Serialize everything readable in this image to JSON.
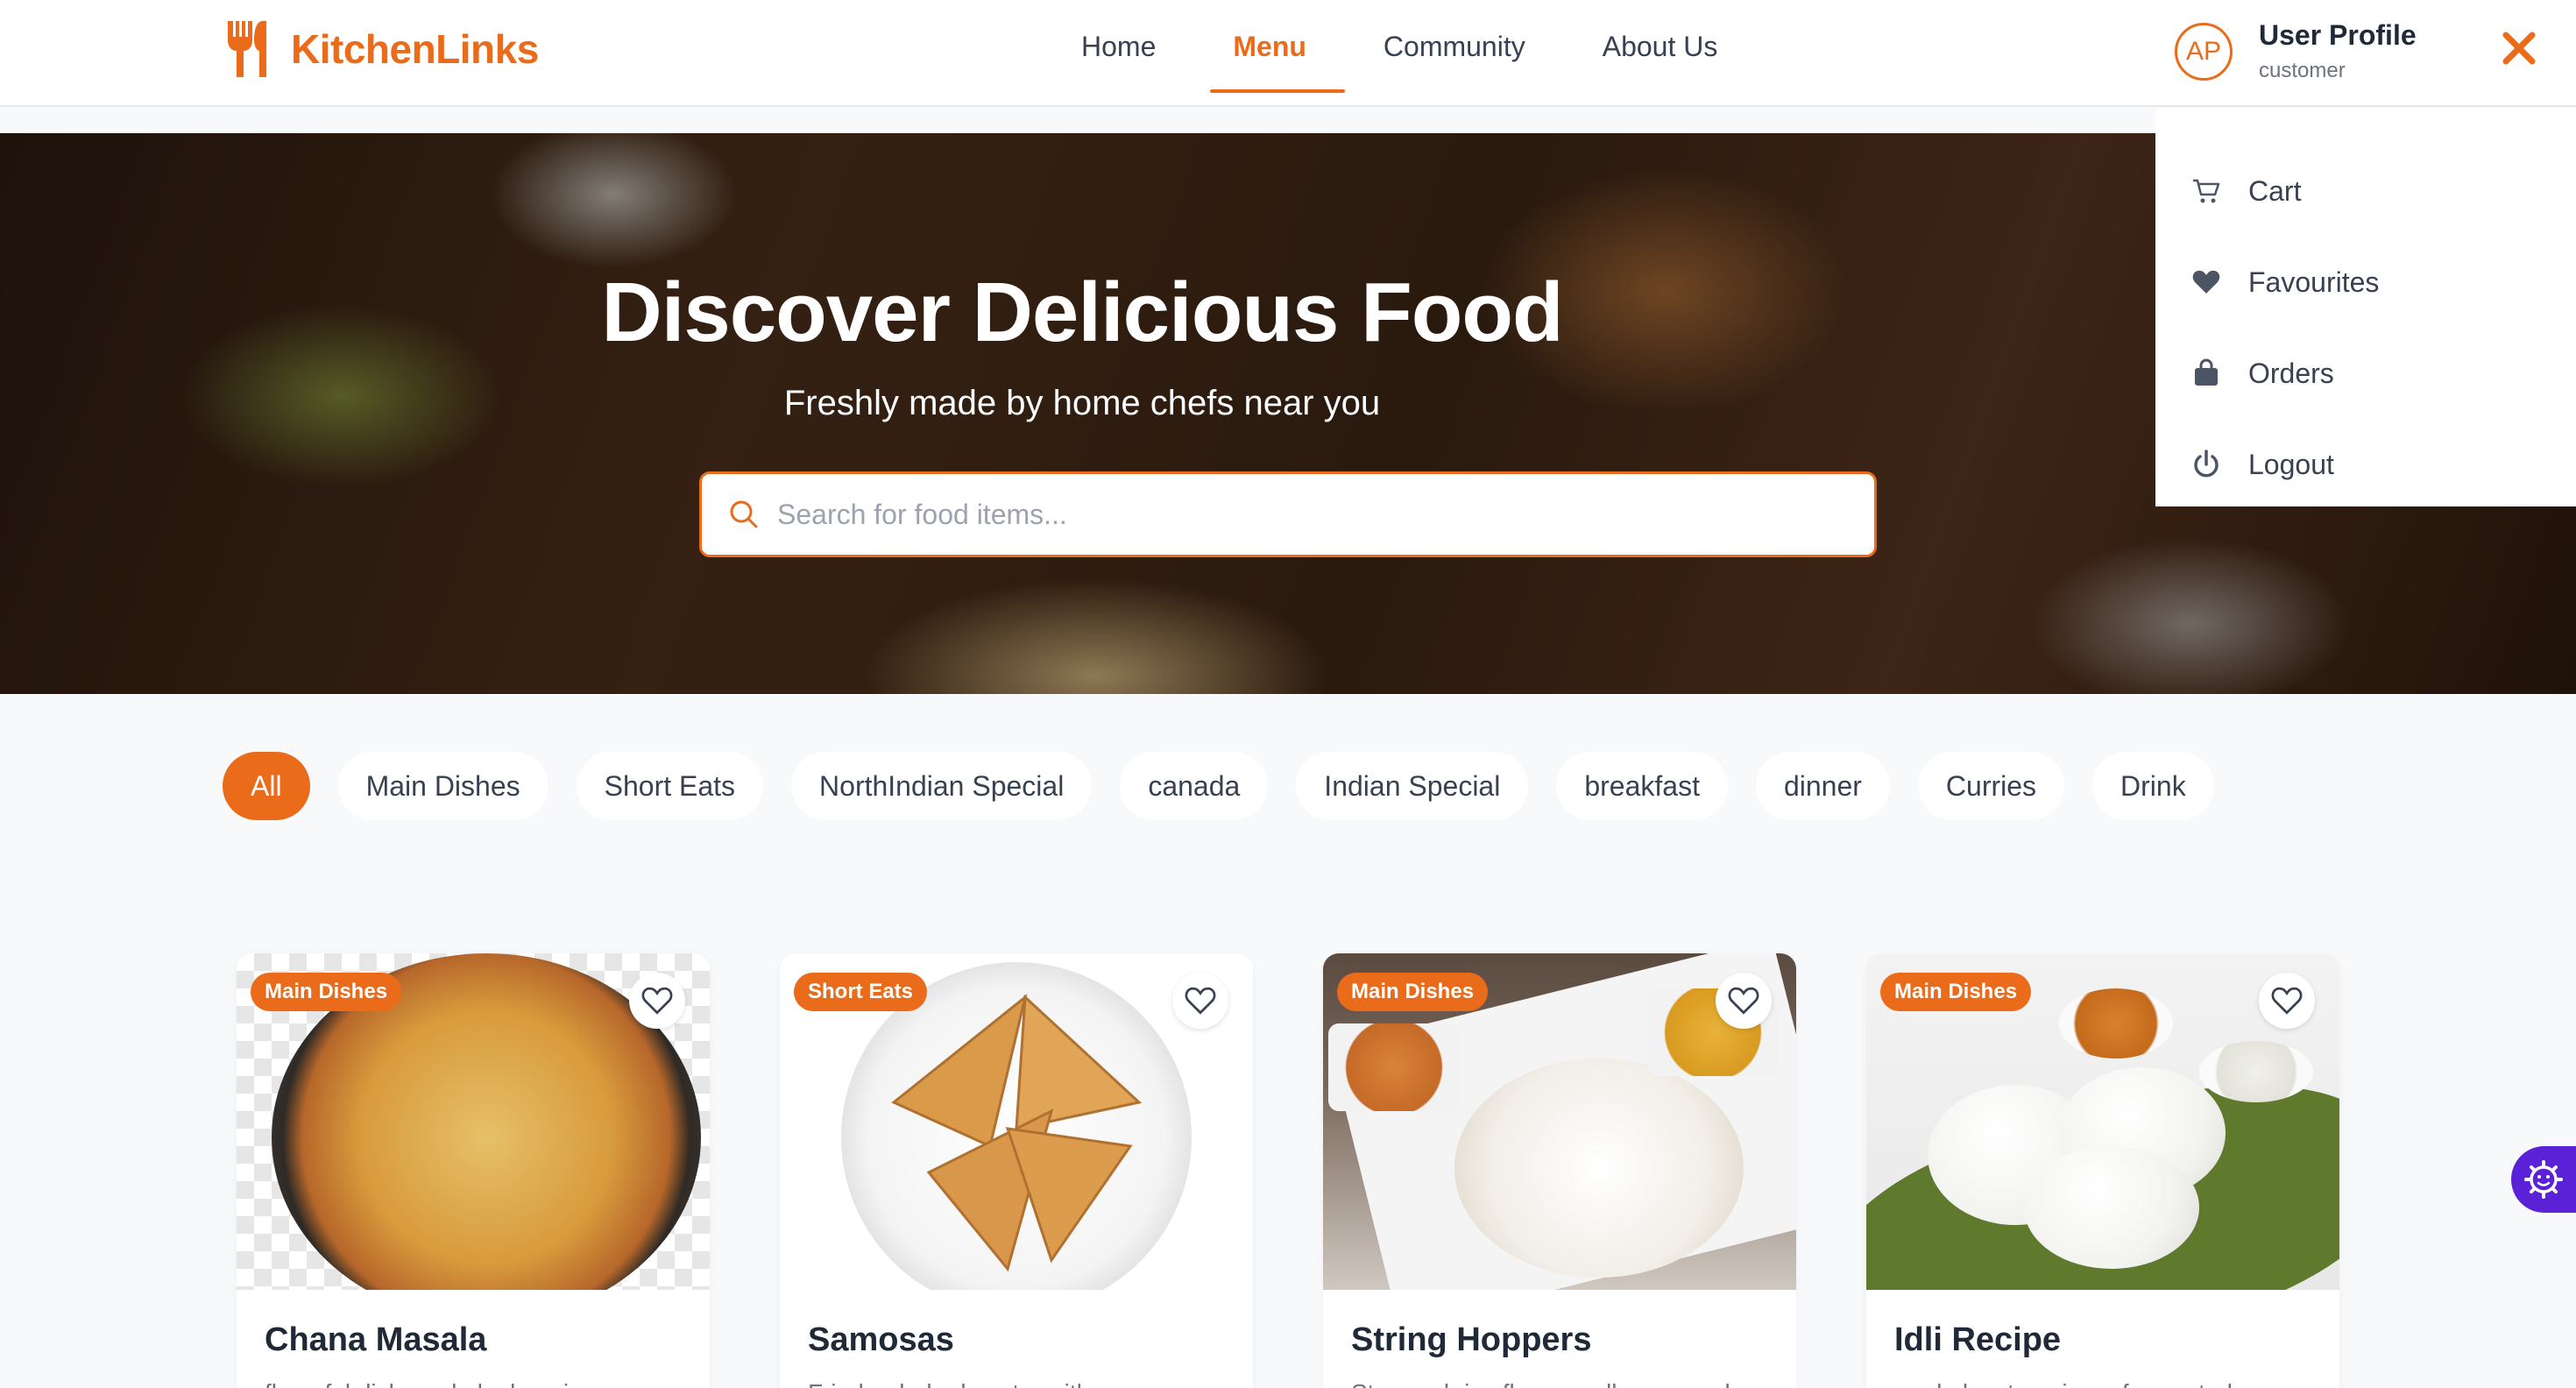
{
  "brand": {
    "name": "KitchenLinks",
    "accent": "#ea6b1a"
  },
  "nav": {
    "items": [
      {
        "label": "Home",
        "active": false
      },
      {
        "label": "Menu",
        "active": true
      },
      {
        "label": "Community",
        "active": false
      },
      {
        "label": "About Us",
        "active": false
      }
    ]
  },
  "profile": {
    "initials": "AP",
    "name": "User Profile",
    "role": "customer",
    "close_icon": "close-x-icon"
  },
  "dropdown": {
    "items": [
      {
        "label": "Cart",
        "icon": "cart-icon"
      },
      {
        "label": "Favourites",
        "icon": "heart-icon"
      },
      {
        "label": "Orders",
        "icon": "bag-icon"
      },
      {
        "label": "Logout",
        "icon": "power-icon"
      }
    ]
  },
  "hero": {
    "title": "Discover Delicious Food",
    "subtitle": "Freshly made by home chefs near you",
    "search_placeholder": "Search for food items..."
  },
  "categories": [
    {
      "label": "All",
      "active": true
    },
    {
      "label": "Main Dishes",
      "active": false
    },
    {
      "label": "Short Eats",
      "active": false
    },
    {
      "label": "NorthIndian Special",
      "active": false
    },
    {
      "label": "canada",
      "active": false
    },
    {
      "label": "Indian Special",
      "active": false
    },
    {
      "label": "breakfast",
      "active": false
    },
    {
      "label": "dinner",
      "active": false
    },
    {
      "label": "Curries",
      "active": false
    },
    {
      "label": "Drink",
      "active": false
    }
  ],
  "cards": [
    {
      "badge": "Main Dishes",
      "title": "Chana Masala",
      "description": "flavorful dish made by layering"
    },
    {
      "badge": "Short Eats",
      "title": "Samosas",
      "description": "Fried or baked pastry with savory"
    },
    {
      "badge": "Main Dishes",
      "title": "String Hoppers",
      "description": "Steamed rice flour noodles, served"
    },
    {
      "badge": "Main Dishes",
      "title": "Idli Recipe",
      "description": "made by steaming a fermented"
    }
  ]
}
